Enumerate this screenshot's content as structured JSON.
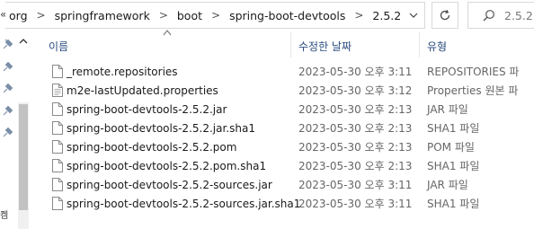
{
  "address": {
    "back_glyph": "«",
    "path": [
      "org",
      "springframework",
      "boot",
      "spring-boot-devtools",
      "2.5.2"
    ],
    "separator": ">"
  },
  "search": {
    "placeholder": "2.5.2"
  },
  "columns": {
    "name": "이름",
    "date": "수정한 날짜",
    "type": "유형"
  },
  "nav": {
    "glyph": "켐"
  },
  "files": [
    {
      "name": "_remote.repositories",
      "date": "2023-05-30 오후 3:11",
      "type": "REPOSITORIES 파",
      "icon": "blank-file-icon"
    },
    {
      "name": "m2e-lastUpdated.properties",
      "date": "2023-05-30 오후 3:12",
      "type": "Properties 원본 파",
      "icon": "text-file-icon"
    },
    {
      "name": "spring-boot-devtools-2.5.2.jar",
      "date": "2023-05-30 오후 2:13",
      "type": "JAR 파일",
      "icon": "blank-file-icon"
    },
    {
      "name": "spring-boot-devtools-2.5.2.jar.sha1",
      "date": "2023-05-30 오후 2:13",
      "type": "SHA1 파일",
      "icon": "blank-file-icon"
    },
    {
      "name": "spring-boot-devtools-2.5.2.pom",
      "date": "2023-05-30 오후 2:13",
      "type": "POM 파일",
      "icon": "blank-file-icon"
    },
    {
      "name": "spring-boot-devtools-2.5.2.pom.sha1",
      "date": "2023-05-30 오후 2:13",
      "type": "SHA1 파일",
      "icon": "blank-file-icon"
    },
    {
      "name": "spring-boot-devtools-2.5.2-sources.jar",
      "date": "2023-05-30 오후 3:11",
      "type": "JAR 파일",
      "icon": "blank-file-icon"
    },
    {
      "name": "spring-boot-devtools-2.5.2-sources.jar.sha1",
      "date": "2023-05-30 오후 3:11",
      "type": "SHA1 파일",
      "icon": "blank-file-icon"
    }
  ],
  "colors": {
    "header_text": "#2b4d80",
    "pin": "#7a8ea8",
    "border": "#d9d9d9"
  }
}
